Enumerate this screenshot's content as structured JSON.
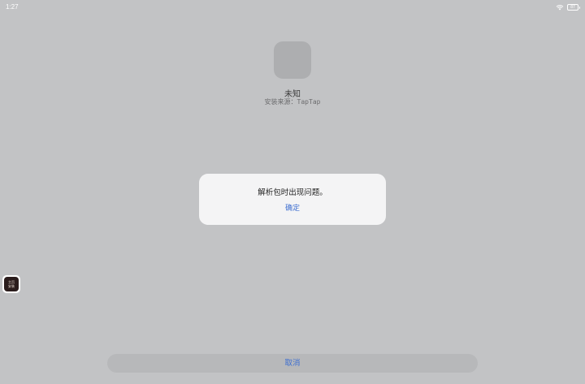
{
  "status_bar": {
    "time": "1:27",
    "battery": "87"
  },
  "app": {
    "name": "未知",
    "source_label": "安装来源：",
    "source_value": "TapTap"
  },
  "dialog": {
    "message": "解析包时出现问题。",
    "confirm_label": "确定"
  },
  "floating_app": {
    "line1": "主页",
    "line2": "安装"
  },
  "footer": {
    "cancel_label": "取消"
  }
}
